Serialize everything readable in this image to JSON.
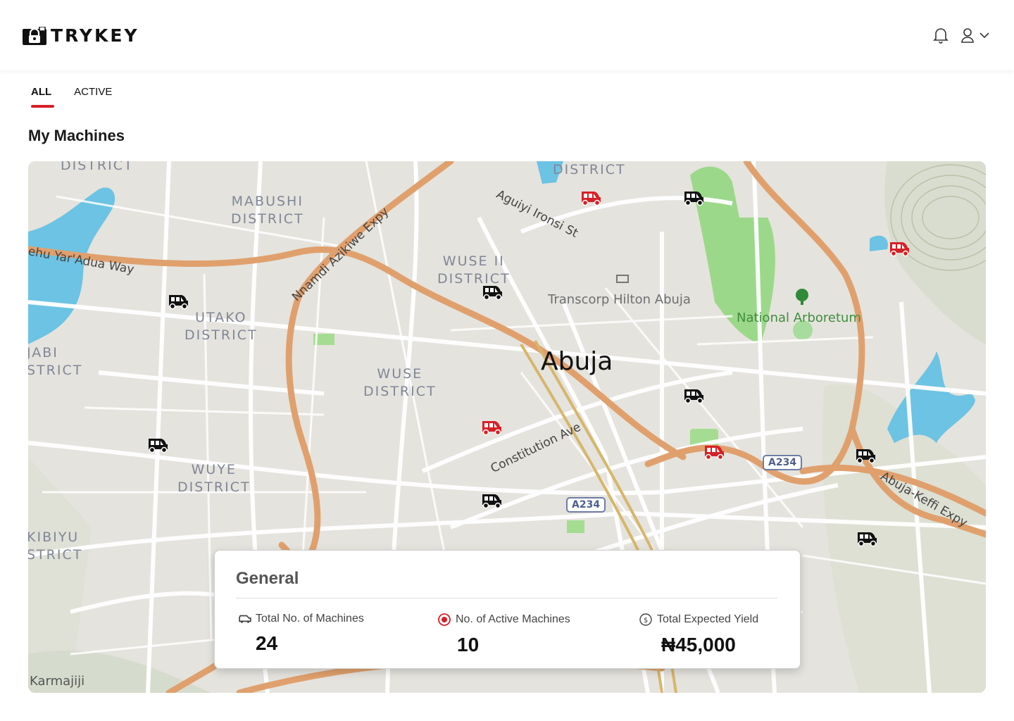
{
  "app": {
    "brand": "TRYKEY"
  },
  "header": {
    "icons": {
      "notifications": "bell-icon",
      "profile": "user-icon",
      "dropdown": "chevron-down-icon"
    }
  },
  "tabs": [
    {
      "label": "ALL",
      "active": true
    },
    {
      "label": "ACTIVE",
      "active": false
    }
  ],
  "page": {
    "title": "My Machines"
  },
  "map": {
    "city": "Abuja",
    "districts": {
      "district_top_left": "DISTRICT",
      "district_top_center": "DISTRICT",
      "mabushi": "MABUSHI\nDISTRICT",
      "wuse2": "WUSE II\nDISTRICT",
      "utako": "UTAKO\nDISTRICT",
      "jabi": "JABI\nSTRICT",
      "wuse": "WUSE\nDISTRICT",
      "wuye": "WUYE\nDISTRICT",
      "kibiyu": "KIBIYU\nSTRICT"
    },
    "roads": {
      "yaradua": "ehu Yar'Adua Way",
      "azikiwe": "Nnamdi Azikiwe Expy",
      "ironsi": "Aguiyi Ironsi St",
      "constitution": "Constitution Ave",
      "keffi": "Abuja-Keffi Expy"
    },
    "shields": [
      "A234",
      "A234"
    ],
    "pois": {
      "hilton": "Transcorp Hilton Abuja",
      "arboretum": "National Arboretum",
      "karmajiji": "Karmajiji"
    },
    "machine_colors": {
      "active": "#d62027",
      "inactive": "#111111"
    },
    "machines": [
      {
        "status": "active"
      },
      {
        "status": "inactive"
      },
      {
        "status": "active"
      },
      {
        "status": "inactive"
      },
      {
        "status": "inactive"
      },
      {
        "status": "inactive"
      },
      {
        "status": "active"
      },
      {
        "status": "inactive"
      },
      {
        "status": "active"
      },
      {
        "status": "inactive"
      },
      {
        "status": "inactive"
      },
      {
        "status": "inactive"
      }
    ]
  },
  "general": {
    "title": "General",
    "stats": [
      {
        "icon": "machine-icon",
        "label": "Total No. of Machines",
        "value": "24"
      },
      {
        "icon": "active-dot-icon",
        "label": "No. of Active Machines",
        "value": "10"
      },
      {
        "icon": "coin-icon",
        "label": "Total Expected Yield",
        "value": "₦45,000"
      }
    ]
  },
  "colors": {
    "accent": "#d62027",
    "map_road_major": "#e0a06d",
    "map_water": "#6cc3e3",
    "map_park": "#8fd17f"
  }
}
